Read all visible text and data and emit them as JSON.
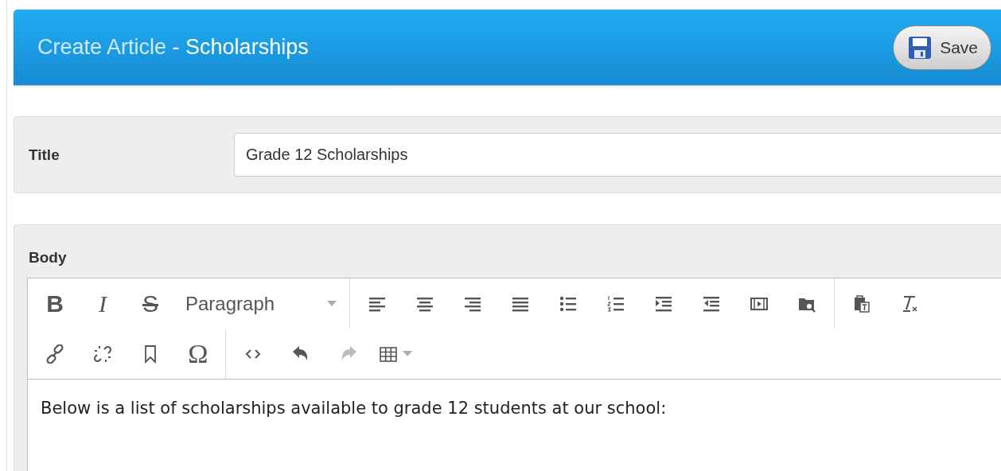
{
  "header": {
    "title_prefix": "Create Article",
    "title_separator": " - ",
    "title_section": "Scholarships",
    "save_button": "Save"
  },
  "title_field": {
    "label": "Title",
    "value": "Grade 12 Scholarships"
  },
  "body_field": {
    "label": "Body",
    "toolbar_rows": [
      [
        [
          {
            "kind": "glyph",
            "glyph": "B",
            "disabled": false
          },
          {
            "kind": "glyph-italic",
            "glyph": "I",
            "disabled": false
          },
          {
            "kind": "glyph-strike",
            "glyph": "S",
            "disabled": false
          },
          {
            "kind": "format-select",
            "label": "Paragraph",
            "disabled": false
          }
        ],
        [
          {
            "kind": "align-left",
            "disabled": false
          },
          {
            "kind": "align-center",
            "disabled": false
          },
          {
            "kind": "align-right",
            "disabled": false
          },
          {
            "kind": "align-justify",
            "disabled": false
          },
          {
            "kind": "bullet-list",
            "disabled": false
          },
          {
            "kind": "numbered-list",
            "disabled": false
          },
          {
            "kind": "indent",
            "disabled": false
          },
          {
            "kind": "outdent",
            "disabled": false
          },
          {
            "kind": "film",
            "disabled": false
          },
          {
            "kind": "folder-search",
            "disabled": false
          }
        ],
        [
          {
            "kind": "paste-text",
            "disabled": false
          },
          {
            "kind": "clear-format",
            "disabled": false
          }
        ]
      ],
      [
        [
          {
            "kind": "link",
            "disabled": false
          },
          {
            "kind": "unlink",
            "disabled": false
          },
          {
            "kind": "bookmark",
            "disabled": false
          },
          {
            "kind": "glyph",
            "glyph": "Ω",
            "disabled": false
          }
        ],
        [
          {
            "kind": "code",
            "disabled": false
          },
          {
            "kind": "undo",
            "disabled": false
          },
          {
            "kind": "redo",
            "disabled": true
          },
          {
            "kind": "table",
            "disabled": false
          }
        ]
      ]
    ],
    "content": "Below is a list of scholarships available to grade 12 students at our school:"
  }
}
